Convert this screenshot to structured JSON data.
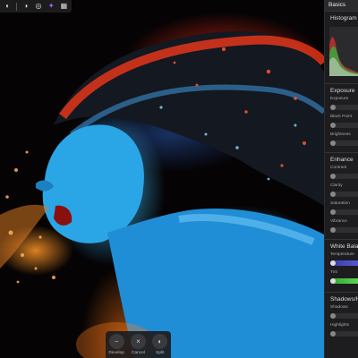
{
  "toolbar": {
    "icons": [
      "grid-icon",
      "circle-half-icon",
      "compare-icon",
      "brush-icon",
      "film-strip-icon"
    ]
  },
  "panel": {
    "header": "Basics",
    "histogram": {
      "title": "Histogram"
    },
    "exposure": {
      "title": "Exposure",
      "controls": [
        {
          "label": "Exposure",
          "value": 0.5
        },
        {
          "label": "Black Point",
          "value": 0.5
        },
        {
          "label": "Brightness",
          "value": 0.5
        }
      ]
    },
    "enhance": {
      "title": "Enhance",
      "controls": [
        {
          "label": "Contrast",
          "value": 0.5
        },
        {
          "label": "Clarity",
          "value": 0.5
        },
        {
          "label": "Saturation",
          "value": 0.5
        },
        {
          "label": "Vibrance",
          "value": 0.5
        }
      ]
    },
    "white_balance": {
      "title": "White Balance",
      "controls": [
        {
          "label": "Temperature",
          "value": 0.5,
          "color": "#5050d0"
        },
        {
          "label": "Tint",
          "value": 0.5,
          "color": "#4fd04a"
        }
      ]
    },
    "shadows": {
      "title": "Shadows/Hig",
      "controls": [
        {
          "label": "Shadows",
          "value": 0.5
        },
        {
          "label": "Highlights",
          "value": 0.5
        }
      ]
    }
  },
  "actionbar": {
    "revert": {
      "label": "Develop",
      "icon": "minus-icon"
    },
    "cancel": {
      "label": "Cancel",
      "icon": "x-icon"
    },
    "split": {
      "label": "Split",
      "icon": "split-icon"
    }
  },
  "colors": {
    "accent": "#a86bff",
    "panel_bg": "#1d1d1f"
  }
}
